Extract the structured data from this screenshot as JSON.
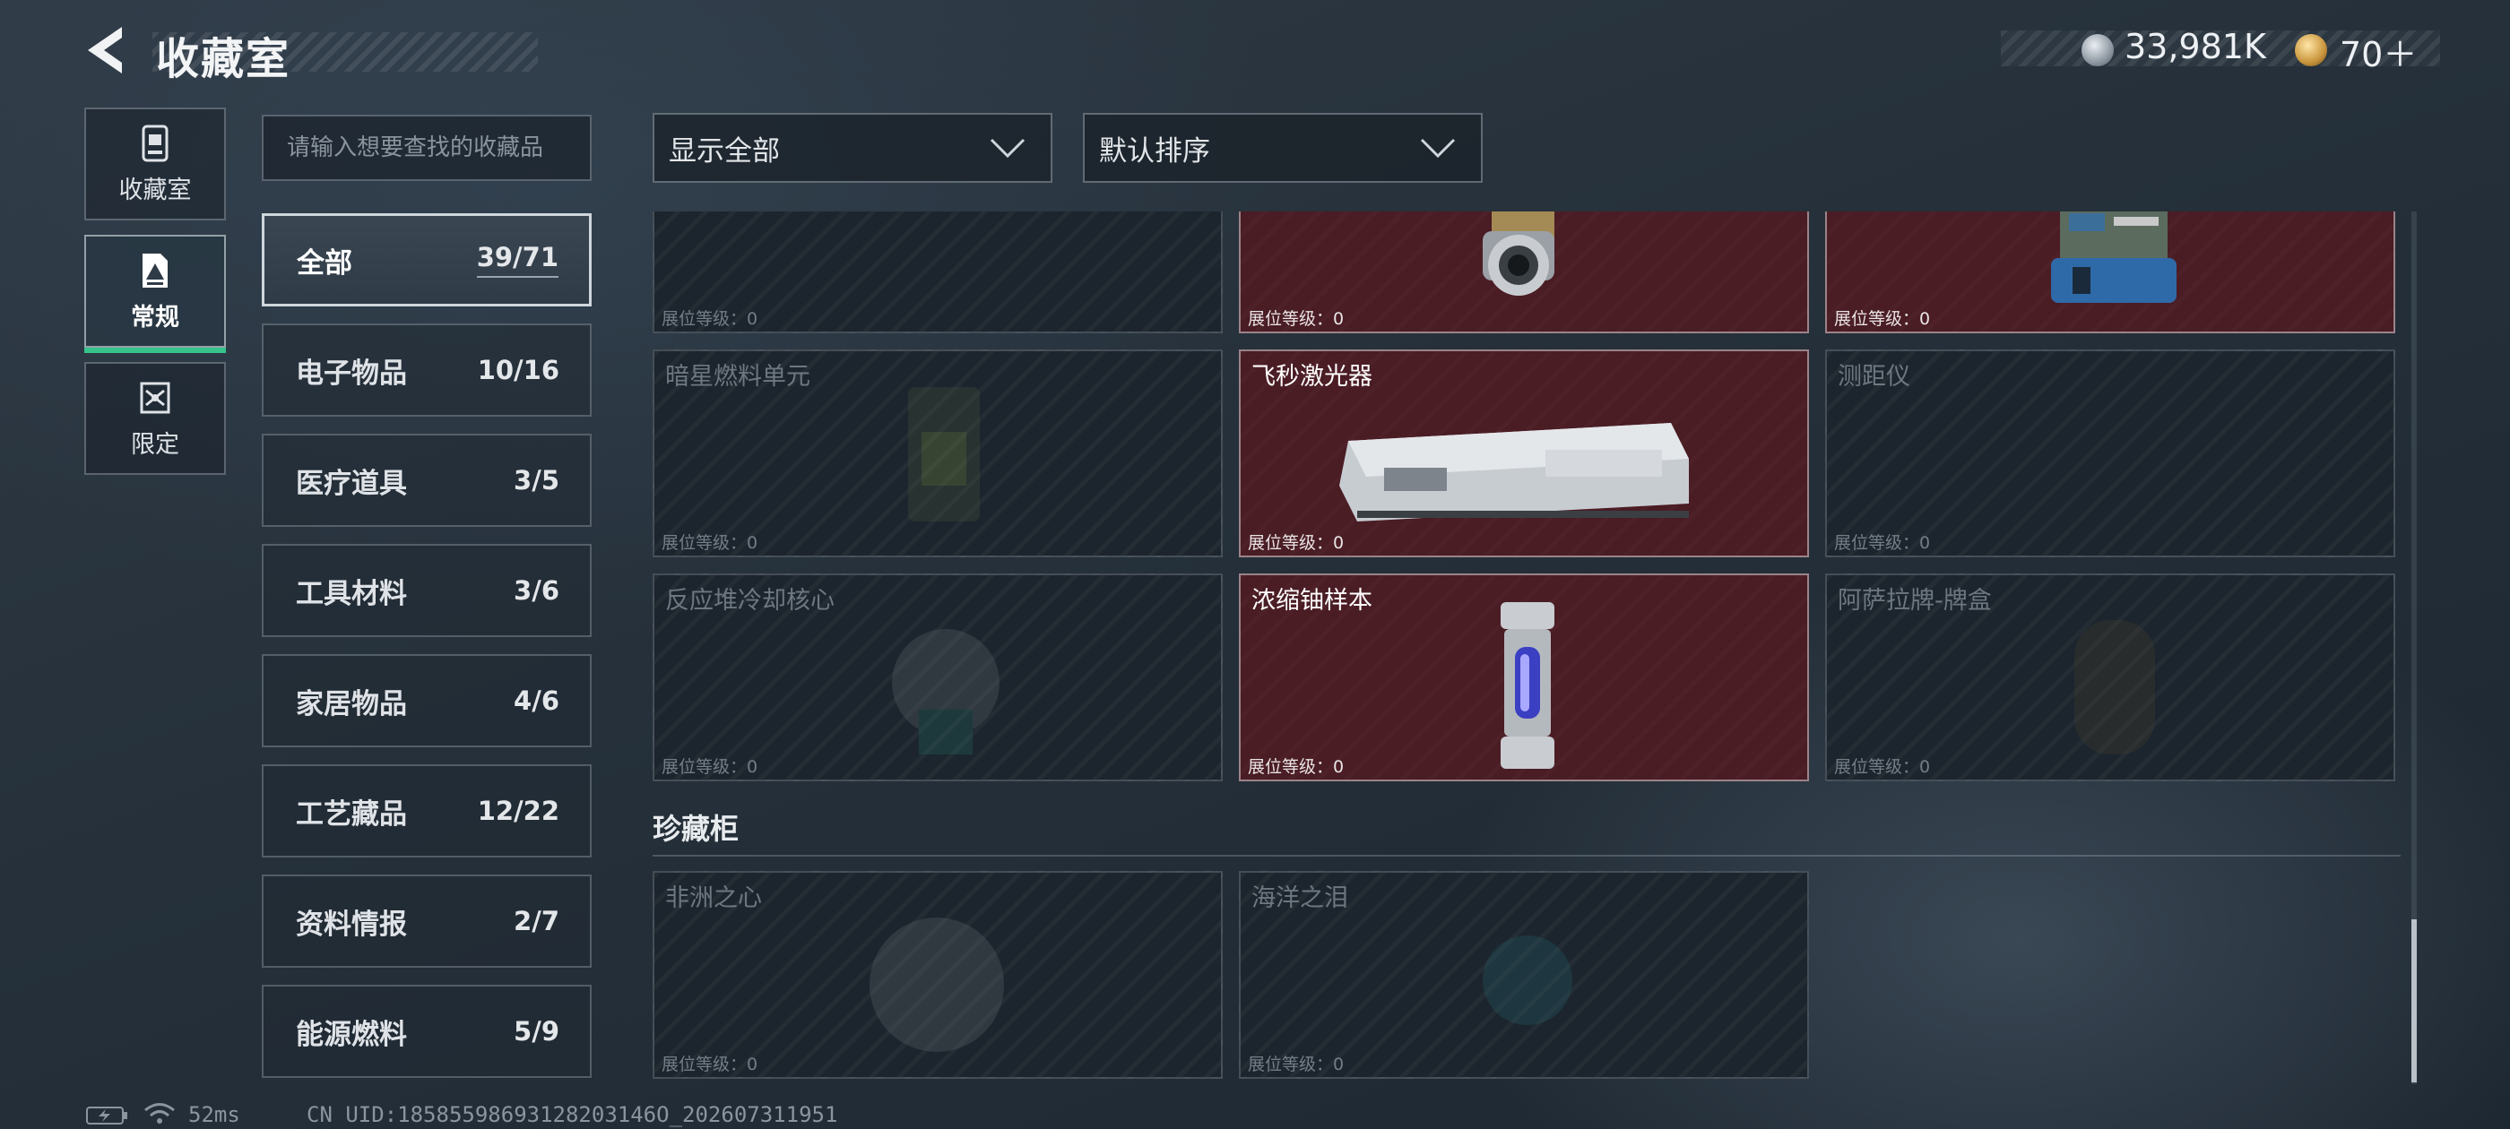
{
  "header": {
    "title": "收藏室",
    "back_icon": "back-arrow-icon",
    "currencies": [
      {
        "icon": "silver-coin-icon",
        "value": "33,981K"
      },
      {
        "icon": "gold-coin-icon",
        "value": "70＋"
      }
    ]
  },
  "side_tabs": [
    {
      "label": "收藏室",
      "icon": "collection-room-icon",
      "active": false
    },
    {
      "label": "常规",
      "icon": "regular-icon",
      "active": true
    },
    {
      "label": "限定",
      "icon": "limited-icon",
      "active": false
    }
  ],
  "search": {
    "placeholder": "请输入想要查找的收藏品"
  },
  "categories": [
    {
      "name": "全部",
      "count": "39/71",
      "active": true
    },
    {
      "name": "电子物品",
      "count": "10/16"
    },
    {
      "name": "医疗道具",
      "count": "3/5"
    },
    {
      "name": "工具材料",
      "count": "3/6"
    },
    {
      "name": "家居物品",
      "count": "4/6"
    },
    {
      "name": "工艺藏品",
      "count": "12/22"
    },
    {
      "name": "资料情报",
      "count": "2/7"
    },
    {
      "name": "能源燃料",
      "count": "5/9"
    }
  ],
  "filters": {
    "display": "显示全部",
    "sort": "默认排序"
  },
  "level_label": "展位等级：0",
  "items": [
    {
      "name": "",
      "owned": false
    },
    {
      "name": "",
      "owned": true
    },
    {
      "name": "",
      "owned": true
    },
    {
      "name": "暗星燃料单元",
      "owned": false
    },
    {
      "name": "飞秒激光器",
      "owned": true
    },
    {
      "name": "测距仪",
      "owned": false
    },
    {
      "name": "反应堆冷却核心",
      "owned": false
    },
    {
      "name": "浓缩铀样本",
      "owned": true
    },
    {
      "name": "阿萨拉牌-牌盒",
      "owned": false
    }
  ],
  "section": {
    "title": "珍藏柜",
    "items": [
      {
        "name": "非洲之心",
        "owned": false
      },
      {
        "name": "海洋之泪",
        "owned": false
      }
    ]
  },
  "footer": {
    "ping": "52ms",
    "uid": "CN UID:18585598693128203146O_202607311951"
  },
  "colors": {
    "owned_card": "#4a1c24",
    "empty_card": "#1c252d",
    "active_tab_underline": "#36c48c"
  }
}
